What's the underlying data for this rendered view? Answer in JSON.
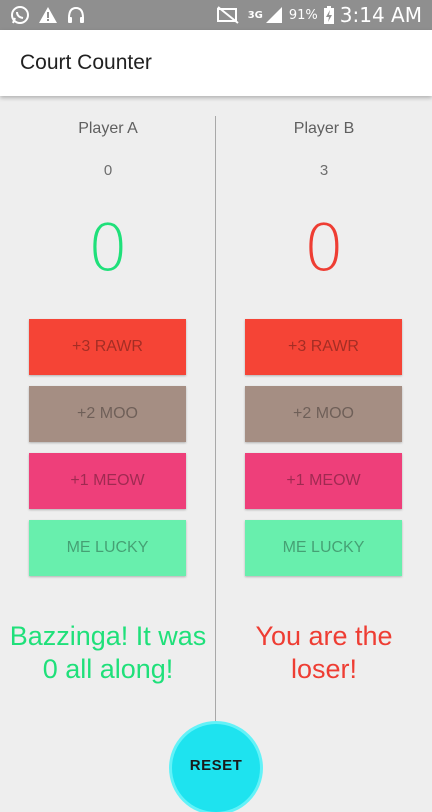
{
  "status_bar": {
    "icons_left": [
      "whatsapp-icon",
      "warning-icon",
      "headphones-icon"
    ],
    "network": "3G",
    "battery": "91%",
    "time": "3:14 AM"
  },
  "app": {
    "title": "Court Counter"
  },
  "player_a": {
    "label": "Player A",
    "small_score": "0",
    "big_score": "0",
    "score_color": "#1fe07a",
    "buttons": [
      {
        "label": "+3 RAWR",
        "color": "#f54436"
      },
      {
        "label": "+2 MOO",
        "color": "#a58e83"
      },
      {
        "label": "+1 MEOW",
        "color": "#ee3f7a"
      },
      {
        "label": "ME LUCKY",
        "color": "#68efad"
      }
    ],
    "message": "Bazzinga! It was 0 all along!",
    "message_color": "#1fe07a"
  },
  "player_b": {
    "label": "Player B",
    "small_score": "3",
    "big_score": "0",
    "score_color": "#ee3d33",
    "buttons": [
      {
        "label": "+3 RAWR",
        "color": "#f54436"
      },
      {
        "label": "+2 MOO",
        "color": "#a58e83"
      },
      {
        "label": "+1 MEOW",
        "color": "#ee3f7a"
      },
      {
        "label": "ME LUCKY",
        "color": "#68efad"
      }
    ],
    "message": "You are the loser!",
    "message_color": "#ee3d33"
  },
  "reset": {
    "label": "RESET"
  }
}
